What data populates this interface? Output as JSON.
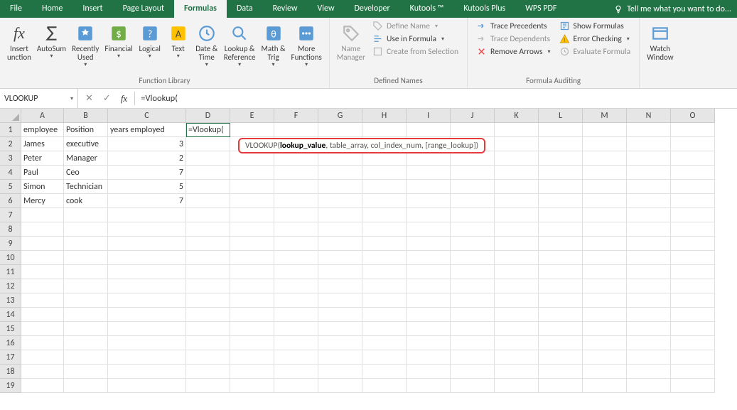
{
  "tabs": {
    "file": "File",
    "home": "Home",
    "insert": "Insert",
    "page_layout": "Page Layout",
    "formulas": "Formulas",
    "data": "Data",
    "review": "Review",
    "view": "View",
    "developer": "Developer",
    "kutools": "Kutools ™",
    "kutools_plus": "Kutools Plus",
    "wps_pdf": "WPS PDF",
    "tell_me": "Tell me what you want to do..."
  },
  "ribbon": {
    "insert_fn": "Insert\nunction",
    "autosum": "AutoSum",
    "recently": "Recently\nUsed",
    "financial": "Financial",
    "logical": "Logical",
    "text": "Text",
    "datetime": "Date &\nTime",
    "lookup": "Lookup &\nReference",
    "math": "Math &\nTrig",
    "more_fn": "More\nFunctions",
    "group_fnlib": "Function Library",
    "name_mgr": "Name\nManager",
    "define_name": "Define Name",
    "use_in_formula": "Use in Formula",
    "create_sel": "Create from Selection",
    "group_defined": "Defined Names",
    "trace_prec": "Trace Precedents",
    "trace_dep": "Trace Dependents",
    "remove_arrows": "Remove Arrows",
    "show_formulas": "Show Formulas",
    "error_check": "Error Checking",
    "eval_formula": "Evaluate Formula",
    "group_audit": "Formula Auditing",
    "watch": "Watch\nWindow"
  },
  "formula_bar": {
    "name_box": "VLOOKUP",
    "formula": "=Vlookup("
  },
  "columns": [
    "A",
    "B",
    "C",
    "D",
    "E",
    "F",
    "G",
    "H",
    "I",
    "J",
    "K",
    "L",
    "M",
    "N",
    "O"
  ],
  "rows_shown": 19,
  "data_rows": [
    {
      "A": "employee",
      "B": "Position",
      "C": "years employed",
      "D": "=Vlookup("
    },
    {
      "A": "James",
      "B": "executive",
      "C": "3"
    },
    {
      "A": "Peter",
      "B": "Manager",
      "C": "2"
    },
    {
      "A": "Paul",
      "B": "Ceo",
      "C": "7"
    },
    {
      "A": "Simon",
      "B": "Technician",
      "C": "5"
    },
    {
      "A": "Mercy",
      "B": "cook",
      "C": "7"
    }
  ],
  "tooltip": {
    "fn": "VLOOKUP(",
    "bold_arg": "lookup_value",
    "rest": ", table_array, col_index_num, [range_lookup])"
  }
}
